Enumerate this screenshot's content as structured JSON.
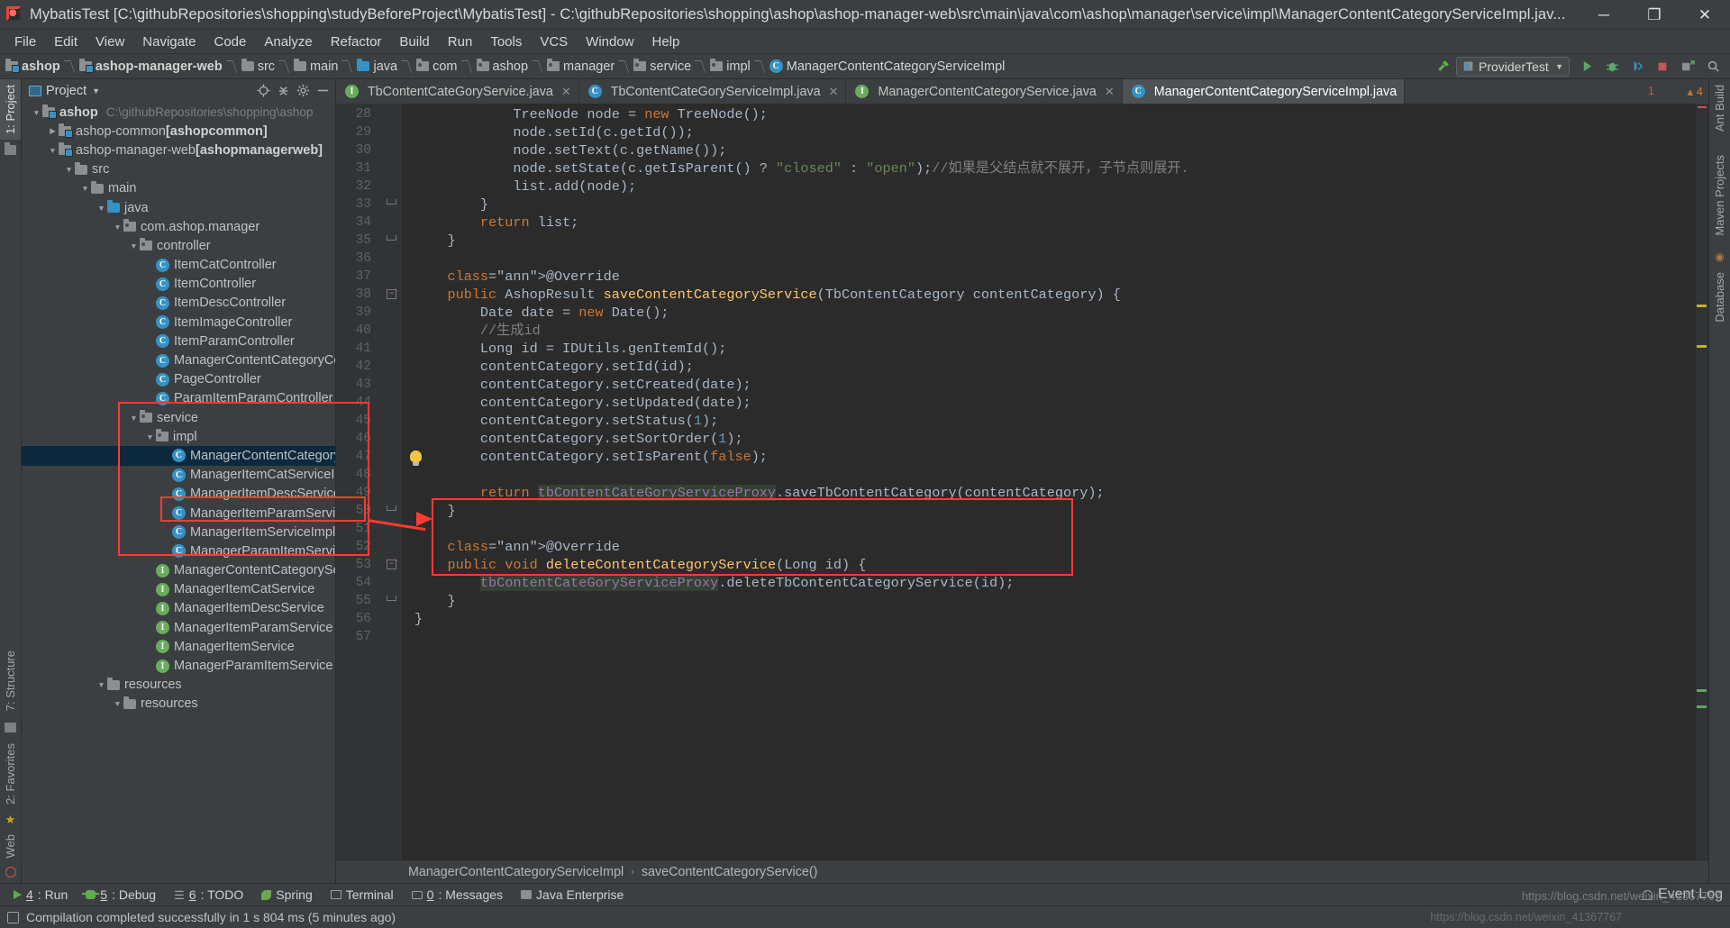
{
  "window": {
    "title": "MybatisTest [C:\\githubRepositories\\shopping\\studyBeforeProject\\MybatisTest] - C:\\githubRepositories\\shopping\\ashop\\ashop-manager-web\\src\\main\\java\\com\\ashop\\manager\\service\\impl\\ManagerContentCategoryServiceImpl.jav...",
    "minimize": "─",
    "maximize": "❐",
    "close": "✕"
  },
  "menubar": [
    "File",
    "Edit",
    "View",
    "Navigate",
    "Code",
    "Analyze",
    "Refactor",
    "Build",
    "Run",
    "Tools",
    "VCS",
    "Window",
    "Help"
  ],
  "navbar": {
    "crumbs": [
      {
        "label": "ashop",
        "icon": "module-icon",
        "bold": true
      },
      {
        "label": "ashop-manager-web",
        "icon": "module-icon",
        "bold": true
      },
      {
        "label": "src",
        "icon": "folder-icon",
        "bold": false
      },
      {
        "label": "main",
        "icon": "folder-icon",
        "bold": false
      },
      {
        "label": "java",
        "icon": "source-folder-icon",
        "bold": false
      },
      {
        "label": "com",
        "icon": "package-icon",
        "bold": false
      },
      {
        "label": "ashop",
        "icon": "package-icon",
        "bold": false
      },
      {
        "label": "manager",
        "icon": "package-icon",
        "bold": false
      },
      {
        "label": "service",
        "icon": "package-icon",
        "bold": false
      },
      {
        "label": "impl",
        "icon": "package-icon",
        "bold": false
      },
      {
        "label": "ManagerContentCategoryServiceImpl",
        "icon": "class-icon",
        "bold": false
      }
    ],
    "run_config": "ProviderTest",
    "run_config_caret": "▼"
  },
  "project_panel": {
    "header_title": "Project",
    "header_caret": "▼",
    "tool_tabs_left": [
      "1: Project",
      "7: Structure",
      "2: Favorites",
      "Web"
    ],
    "tree": [
      {
        "indent": 0,
        "twisty": "▼",
        "icon": "module-icon",
        "label": "ashop",
        "sub": "C:\\githubRepositories\\shopping\\ashop",
        "bold": true,
        "selected": false
      },
      {
        "indent": 1,
        "twisty": "▶",
        "icon": "module-icon",
        "label": "ashop-common [ashopcommon]",
        "sub": "",
        "bold": false,
        "selected": false
      },
      {
        "indent": 1,
        "twisty": "▼",
        "icon": "module-icon",
        "label": "ashop-manager-web [ashopmanagerweb]",
        "sub": "",
        "bold": false,
        "selected": false
      },
      {
        "indent": 2,
        "twisty": "▼",
        "icon": "folder-icon",
        "label": "src",
        "sub": "",
        "bold": false,
        "selected": false
      },
      {
        "indent": 3,
        "twisty": "▼",
        "icon": "folder-icon",
        "label": "main",
        "sub": "",
        "bold": false,
        "selected": false
      },
      {
        "indent": 4,
        "twisty": "▼",
        "icon": "source-folder-icon",
        "label": "java",
        "sub": "",
        "bold": false,
        "selected": false
      },
      {
        "indent": 5,
        "twisty": "▼",
        "icon": "package-icon",
        "label": "com.ashop.manager",
        "sub": "",
        "bold": false,
        "selected": false
      },
      {
        "indent": 6,
        "twisty": "▼",
        "icon": "package-icon",
        "label": "controller",
        "sub": "",
        "bold": false,
        "selected": false
      },
      {
        "indent": 7,
        "twisty": "",
        "icon": "class-icon",
        "label": "ItemCatController",
        "sub": "",
        "bold": false,
        "selected": false
      },
      {
        "indent": 7,
        "twisty": "",
        "icon": "class-icon",
        "label": "ItemController",
        "sub": "",
        "bold": false,
        "selected": false
      },
      {
        "indent": 7,
        "twisty": "",
        "icon": "class-icon",
        "label": "ItemDescController",
        "sub": "",
        "bold": false,
        "selected": false
      },
      {
        "indent": 7,
        "twisty": "",
        "icon": "class-icon",
        "label": "ItemImageController",
        "sub": "",
        "bold": false,
        "selected": false
      },
      {
        "indent": 7,
        "twisty": "",
        "icon": "class-icon",
        "label": "ItemParamController",
        "sub": "",
        "bold": false,
        "selected": false
      },
      {
        "indent": 7,
        "twisty": "",
        "icon": "class-icon",
        "label": "ManagerContentCategoryCont",
        "sub": "",
        "bold": false,
        "selected": false
      },
      {
        "indent": 7,
        "twisty": "",
        "icon": "class-icon",
        "label": "PageController",
        "sub": "",
        "bold": false,
        "selected": false
      },
      {
        "indent": 7,
        "twisty": "",
        "icon": "class-icon",
        "label": "ParamItemParamController",
        "sub": "",
        "bold": false,
        "selected": false
      },
      {
        "indent": 6,
        "twisty": "▼",
        "icon": "package-icon",
        "label": "service",
        "sub": "",
        "bold": false,
        "selected": false
      },
      {
        "indent": 7,
        "twisty": "▼",
        "icon": "package-icon",
        "label": "impl",
        "sub": "",
        "bold": false,
        "selected": false
      },
      {
        "indent": 8,
        "twisty": "",
        "icon": "class-icon",
        "label": "ManagerContentCategoryS",
        "sub": "",
        "bold": false,
        "selected": true
      },
      {
        "indent": 8,
        "twisty": "",
        "icon": "class-icon",
        "label": "ManagerItemCatServiceImp",
        "sub": "",
        "bold": false,
        "selected": false
      },
      {
        "indent": 8,
        "twisty": "",
        "icon": "class-icon",
        "label": "ManagerItemDescServiceIm",
        "sub": "",
        "bold": false,
        "selected": false
      },
      {
        "indent": 8,
        "twisty": "",
        "icon": "class-icon",
        "label": "ManagerItemParamServiceImpl",
        "sub": "",
        "bold": false,
        "selected": false
      },
      {
        "indent": 8,
        "twisty": "",
        "icon": "class-icon",
        "label": "ManagerItemServiceImpl",
        "sub": "",
        "bold": false,
        "selected": false
      },
      {
        "indent": 8,
        "twisty": "",
        "icon": "class-icon",
        "label": "ManagerParamItemServiceI",
        "sub": "",
        "bold": false,
        "selected": false
      },
      {
        "indent": 7,
        "twisty": "",
        "icon": "interface-icon",
        "label": "ManagerContentCategoryServ",
        "sub": "",
        "bold": false,
        "selected": false
      },
      {
        "indent": 7,
        "twisty": "",
        "icon": "interface-icon",
        "label": "ManagerItemCatService",
        "sub": "",
        "bold": false,
        "selected": false
      },
      {
        "indent": 7,
        "twisty": "",
        "icon": "interface-icon",
        "label": "ManagerItemDescService",
        "sub": "",
        "bold": false,
        "selected": false
      },
      {
        "indent": 7,
        "twisty": "",
        "icon": "interface-icon",
        "label": "ManagerItemParamService",
        "sub": "",
        "bold": false,
        "selected": false
      },
      {
        "indent": 7,
        "twisty": "",
        "icon": "interface-icon",
        "label": "ManagerItemService",
        "sub": "",
        "bold": false,
        "selected": false
      },
      {
        "indent": 7,
        "twisty": "",
        "icon": "interface-icon",
        "label": "ManagerParamItemService",
        "sub": "",
        "bold": false,
        "selected": false
      },
      {
        "indent": 4,
        "twisty": "▼",
        "icon": "folder-icon",
        "label": "resources",
        "sub": "",
        "bold": false,
        "selected": false
      },
      {
        "indent": 5,
        "twisty": "▼",
        "icon": "folder-icon",
        "label": "resources",
        "sub": "",
        "bold": false,
        "selected": false
      }
    ]
  },
  "editor": {
    "tabs": [
      {
        "label": "TbContentCateGoryService.java",
        "icon": "interface-icon",
        "active": false,
        "close": "✕"
      },
      {
        "label": "TbContentCateGoryServiceImpl.java",
        "icon": "class-icon",
        "active": false,
        "close": "✕"
      },
      {
        "label": "ManagerContentCategoryService.java",
        "icon": "interface-icon",
        "active": false,
        "close": "✕"
      },
      {
        "label": "ManagerContentCategoryServiceImpl.java",
        "icon": "class-icon",
        "active": true,
        "close": ""
      }
    ],
    "warning_count": "1",
    "inspection_summary": "4",
    "first_line_number": 28,
    "lines": [
      {
        "n": 28,
        "text": "            TreeNode node = new TreeNode();"
      },
      {
        "n": 29,
        "text": "            node.setId(c.getId());"
      },
      {
        "n": 30,
        "text": "            node.setText(c.getName());"
      },
      {
        "n": 31,
        "text": "            node.setState(c.getIsParent() ? \"closed\" : \"open\");//如果是父结点就不展开，子节点则展开."
      },
      {
        "n": 32,
        "text": "            list.add(node);"
      },
      {
        "n": 33,
        "text": "        }"
      },
      {
        "n": 34,
        "text": "        return list;"
      },
      {
        "n": 35,
        "text": "    }"
      },
      {
        "n": 36,
        "text": ""
      },
      {
        "n": 37,
        "text": "    @Override"
      },
      {
        "n": 38,
        "text": "    public AshopResult saveContentCategoryService(TbContentCategory contentCategory) {"
      },
      {
        "n": 39,
        "text": "        Date date = new Date();"
      },
      {
        "n": 40,
        "text": "        //生成id"
      },
      {
        "n": 41,
        "text": "        Long id = IDUtils.genItemId();"
      },
      {
        "n": 42,
        "text": "        contentCategory.setId(id);"
      },
      {
        "n": 43,
        "text": "        contentCategory.setCreated(date);"
      },
      {
        "n": 44,
        "text": "        contentCategory.setUpdated(date);"
      },
      {
        "n": 45,
        "text": "        contentCategory.setStatus(1);"
      },
      {
        "n": 46,
        "text": "        contentCategory.setSortOrder(1);"
      },
      {
        "n": 47,
        "text": "        contentCategory.setIsParent(false);"
      },
      {
        "n": 48,
        "text": ""
      },
      {
        "n": 49,
        "text": "        return tbContentCateGoryServiceProxy.saveTbContentCategory(contentCategory);"
      },
      {
        "n": 50,
        "text": "    }"
      },
      {
        "n": 51,
        "text": ""
      },
      {
        "n": 52,
        "text": "    @Override"
      },
      {
        "n": 53,
        "text": "    public void deleteContentCategoryService(Long id) {"
      },
      {
        "n": 54,
        "text": "        tbContentCateGoryServiceProxy.deleteTbContentCategoryService(id);"
      },
      {
        "n": 55,
        "text": "    }"
      },
      {
        "n": 56,
        "text": "}"
      },
      {
        "n": 57,
        "text": ""
      }
    ],
    "breadcrumb": [
      "ManagerContentCategoryServiceImpl",
      "saveContentCategoryService()"
    ],
    "breadcrumb_arrow": "›"
  },
  "right_strip": [
    "Ant Build",
    "Maven Projects",
    "Database"
  ],
  "bottom_toolwindows": [
    {
      "key": "4",
      "label": ": Run",
      "icon": "run-icon"
    },
    {
      "key": "5",
      "label": ": Debug",
      "icon": "debug-icon"
    },
    {
      "key": "6",
      "label": ": TODO",
      "icon": "todo-icon"
    },
    {
      "key": "",
      "label": "Spring",
      "icon": "spring-icon"
    },
    {
      "key": "",
      "label": "Terminal",
      "icon": "terminal-icon"
    },
    {
      "key": "0",
      "label": ": Messages",
      "icon": "messages-icon"
    },
    {
      "key": "",
      "label": "Java Enterprise",
      "icon": "java-enterprise-icon"
    }
  ],
  "statusbar": {
    "message": "Compilation completed successfully in 1 s 804 ms (5 minutes ago)",
    "event_log": "Event Log"
  },
  "watermark": {
    "url": "https://blog.csdn.net/weixin_41367767",
    "tag": "https://blog.csdn.net/weixin_41367767"
  },
  "colors": {
    "accent_red": "#ff3b30",
    "keyword": "#cc7832",
    "string": "#6a8759",
    "number": "#6897bb",
    "comment": "#808080",
    "annotation": "#bbb529",
    "method": "#ffc66d",
    "field": "#9876aa",
    "bg_editor": "#2b2b2b",
    "bg_chrome": "#3c3f41",
    "selection": "#0d293e"
  }
}
